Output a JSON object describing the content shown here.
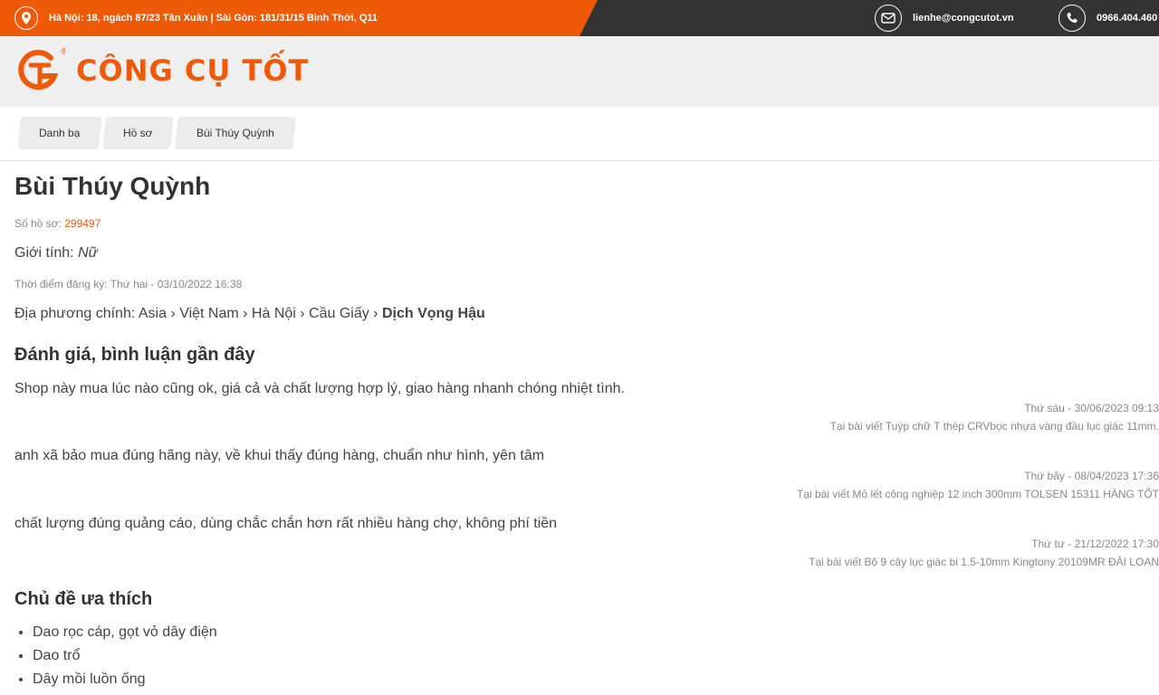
{
  "topbar": {
    "address": "Hà Nội: 18, ngách 87/23 Tân Xuân | Sài Gòn: 181/31/15 Bình Thới, Q11",
    "email": "lienhe@congcutot.vn",
    "phone": "0966.404.460"
  },
  "logo": {
    "text": "CÔNG CỤ TỐT",
    "mark": "GT"
  },
  "breadcrumb": [
    "Danh bạ",
    "Hồ sơ",
    "Bùi Thúy Quỳnh"
  ],
  "profile": {
    "name": "Bùi Thúy Quỳnh",
    "id_label": "Số hồ sơ: ",
    "id_value": "299497",
    "gender_label": "Giới tính: ",
    "gender_value": "Nữ",
    "registered": "Thời điểm đăng ký: Thứ hai - 03/10/2022 16:38",
    "locale_label": "Địa phương chính: ",
    "locale_path": "Asia › Việt Nam › Hà Nội › Cầu Giấy › ",
    "locale_last": "Dịch Vọng Hậu"
  },
  "reviews": {
    "heading": "Đánh giá, bình luận gần đây",
    "items": [
      {
        "text": "Shop này mua lúc nào cũng ok, giá cả và chất lượng hợp lý, giao hàng nhanh chóng nhiệt tình.",
        "date": "Thứ sáu - 30/06/2023 09:13",
        "post": "Tại bài viết Tuýp chữ T thép CRVbọc nhựa vàng đầu lục giác 11mm."
      },
      {
        "text": "anh xã bảo mua đúng hãng này, về khui thấy đúng hàng, chuẩn như hình, yên tâm",
        "date": "Thứ bảy - 08/04/2023 17:36",
        "post": "Tại bài viết Mỏ lết công nghiệp 12 inch 300mm TOLSEN 15311 HÀNG TỐT"
      },
      {
        "text": "chất lượng đúng quảng cáo, dùng chắc chắn hơn rất nhiều hàng chợ, không phí tiền",
        "date": "Thứ tư - 21/12/2022 17:30",
        "post": "Tại bài viết Bộ 9 cây lục giác bi 1.5-10mm Kingtony 20109MR ĐÀI LOAN"
      }
    ]
  },
  "topics": {
    "heading": "Chủ đề ưa thích",
    "items": [
      "Dao rọc cáp, gọt vỏ dây điện",
      "Dao trổ",
      "Dây mồi luồn ống"
    ]
  },
  "colors": {
    "accent": "#ee5a07",
    "dark": "#333333"
  },
  "icons": {
    "location": "location-pin-icon",
    "email": "envelope-icon",
    "phone": "phone-icon"
  }
}
